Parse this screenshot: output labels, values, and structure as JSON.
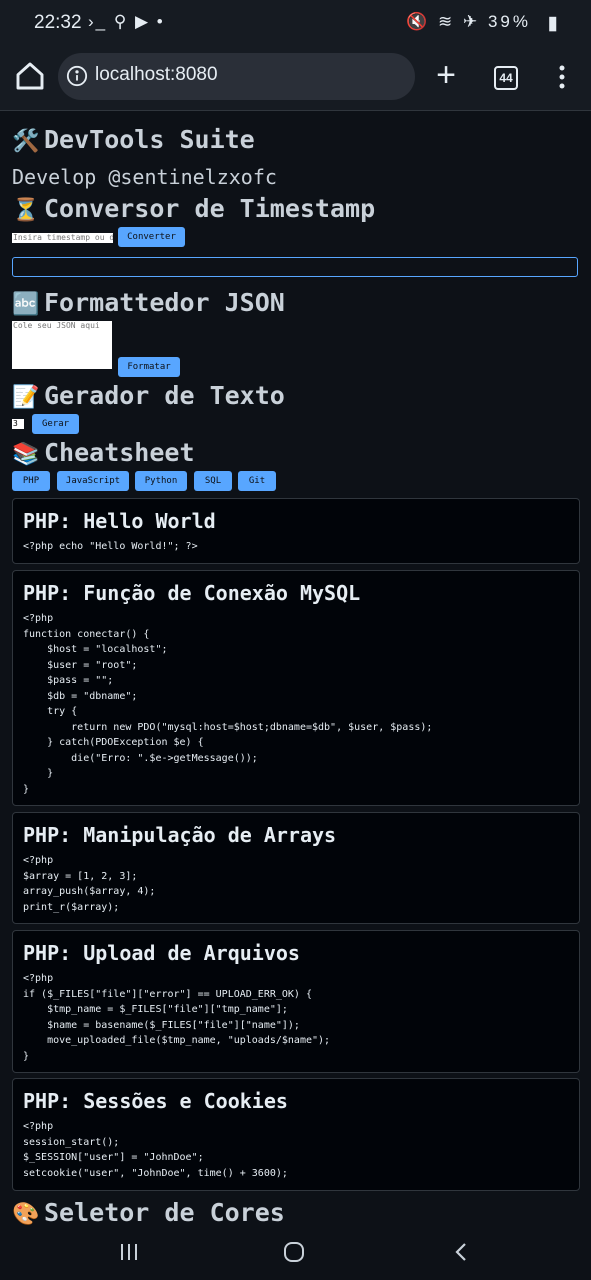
{
  "status_bar": {
    "time": "22:32",
    "left_icons": "›_ ⚲ ▶ •",
    "right_icons": "🔇 ≋ ✈ 39%",
    "battery_percent": "39%"
  },
  "browser": {
    "url": "localhost:8080",
    "tab_count": "44"
  },
  "page": {
    "title_emoji": "🛠️",
    "title": "DevTools Suite",
    "developer": "Develop @sentinelzxofc",
    "timestamp": {
      "emoji": "⏳",
      "heading": "Conversor de Timestamp",
      "input_placeholder": "Insira timestamp ou data",
      "button": "Converter"
    },
    "json": {
      "emoji": "🔤",
      "heading": "Formattedor JSON",
      "textarea_placeholder": "Cole seu JSON aqui",
      "button": "Formatar"
    },
    "text_gen": {
      "emoji": "📝",
      "heading": "Gerador de Texto",
      "input_value": "3",
      "button": "Gerar"
    },
    "cheatsheet": {
      "emoji": "📚",
      "heading": "Cheatsheet",
      "tabs": [
        "PHP",
        "JavaScript",
        "Python",
        "SQL",
        "Git"
      ],
      "cards": [
        {
          "title": "PHP: Hello World",
          "code": "<?php echo \"Hello World!\"; ?>"
        },
        {
          "title": "PHP: Função de Conexão MySQL",
          "code": "<?php\nfunction conectar() {\n    $host = \"localhost\";\n    $user = \"root\";\n    $pass = \"\";\n    $db = \"dbname\";\n    try {\n        return new PDO(\"mysql:host=$host;dbname=$db\", $user, $pass);\n    } catch(PDOException $e) {\n        die(\"Erro: \".$e->getMessage());\n    }\n}"
        },
        {
          "title": "PHP: Manipulação de Arrays",
          "code": "<?php\n$array = [1, 2, 3];\narray_push($array, 4);\nprint_r($array);"
        },
        {
          "title": "PHP: Upload de Arquivos",
          "code": "<?php\nif ($_FILES[\"file\"][\"error\"] == UPLOAD_ERR_OK) {\n    $tmp_name = $_FILES[\"file\"][\"tmp_name\"];\n    $name = basename($_FILES[\"file\"][\"name\"]);\n    move_uploaded_file($tmp_name, \"uploads/$name\");\n}"
        },
        {
          "title": "PHP: Sessões e Cookies",
          "code": "<?php\nsession_start();\n$_SESSION[\"user\"] = \"JohnDoe\";\nsetcookie(\"user\", \"JohnDoe\", time() + 3600);"
        }
      ]
    },
    "color_picker": {
      "emoji": "🎨",
      "heading": "Seletor de Cores"
    }
  },
  "colors": {
    "background": "#0d1117",
    "accent": "#58a6ff",
    "card_bg": "#010409"
  }
}
